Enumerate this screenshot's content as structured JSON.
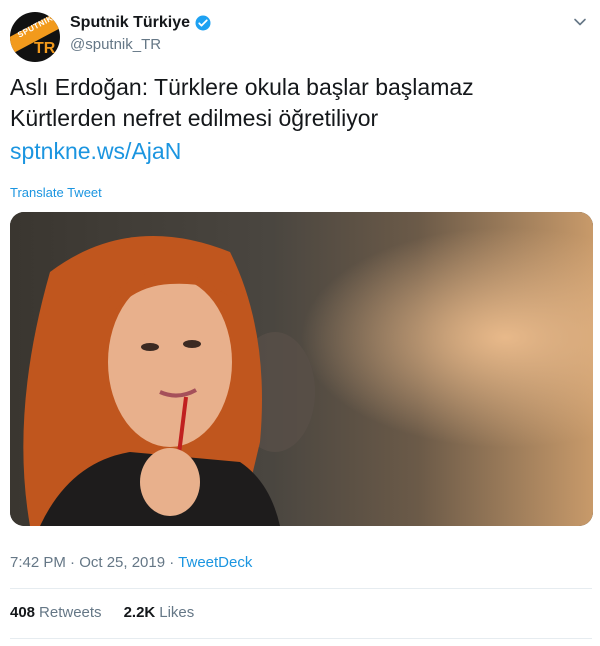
{
  "account": {
    "display_name": "Sputnik Türkiye",
    "handle": "@sputnik_TR",
    "avatar_text": "SPUTNIK",
    "avatar_short": "TR",
    "verified": true
  },
  "tweet": {
    "text": "Aslı Erdoğan: Türklere okula başlar başlamaz Kürtlerden nefret edilmesi öğretiliyor",
    "link": "sptnkne.ws/AjaN",
    "translate_label": "Translate Tweet",
    "time": "7:42 PM · Oct 25, 2019",
    "separator": " · ",
    "source": "TweetDeck"
  },
  "stats": {
    "retweets_count": "408",
    "retweets_label": "Retweets",
    "likes_count": "2.2K",
    "likes_label": "Likes"
  },
  "colors": {
    "link": "#1b95e0",
    "secondary_text": "#657786",
    "verified": "#1da1f2",
    "brand_orange": "#f29a1c"
  },
  "icons": {
    "verified": "verified-badge-icon",
    "caret": "chevron-down-icon"
  }
}
